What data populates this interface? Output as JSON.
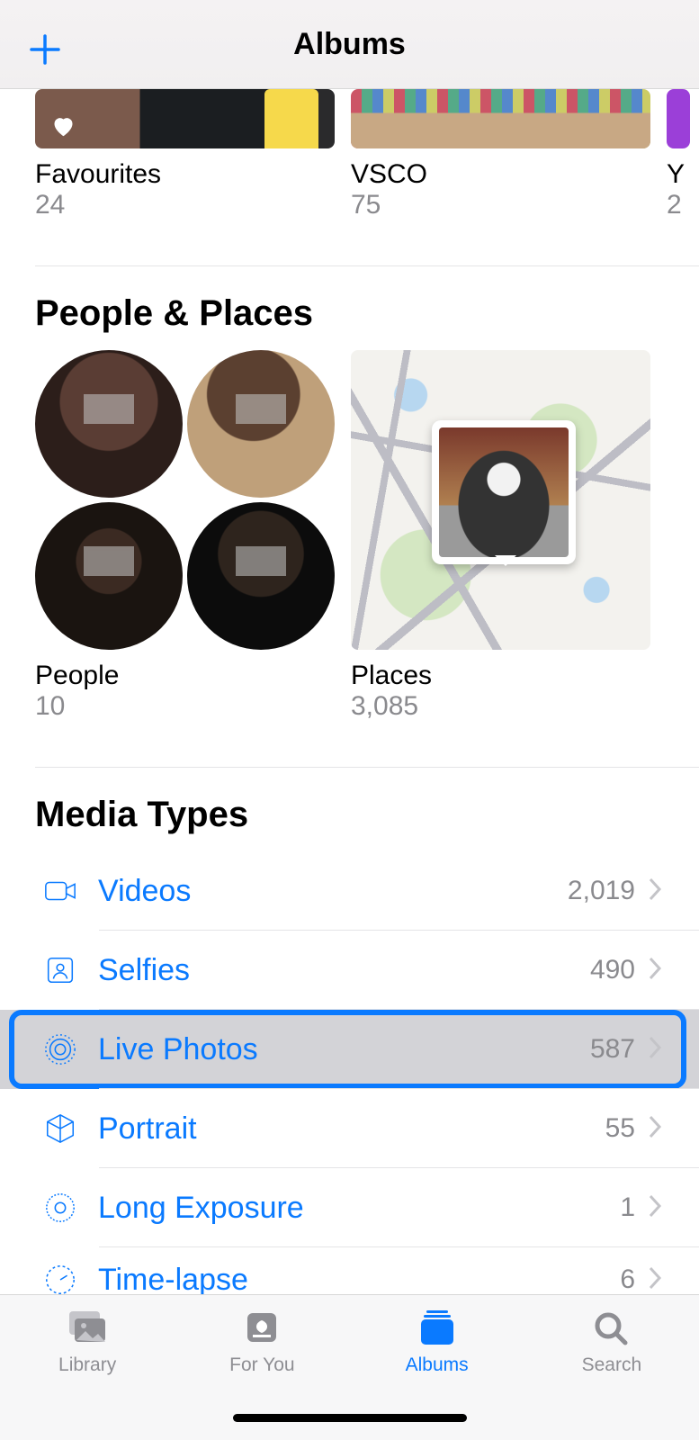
{
  "header": {
    "title": "Albums"
  },
  "myAlbums": [
    {
      "title": "Favourites",
      "count": "24"
    },
    {
      "title": "VSCO",
      "count": "75"
    },
    {
      "title": "Y",
      "count": "2"
    }
  ],
  "sections": {
    "peoplePlaces": "People & Places",
    "mediaTypes": "Media Types"
  },
  "peoplePlaces": [
    {
      "title": "People",
      "count": "10"
    },
    {
      "title": "Places",
      "count": "3,085"
    }
  ],
  "mediaTypes": [
    {
      "label": "Videos",
      "count": "2,019",
      "icon": "video"
    },
    {
      "label": "Selfies",
      "count": "490",
      "icon": "selfie"
    },
    {
      "label": "Live Photos",
      "count": "587",
      "icon": "live",
      "highlight": true
    },
    {
      "label": "Portrait",
      "count": "55",
      "icon": "cube"
    },
    {
      "label": "Long Exposure",
      "count": "1",
      "icon": "longexp"
    },
    {
      "label": "Time-lapse",
      "count": "6",
      "icon": "timelapse"
    }
  ],
  "tabs": [
    {
      "label": "Library"
    },
    {
      "label": "For You"
    },
    {
      "label": "Albums",
      "active": true
    },
    {
      "label": "Search"
    }
  ]
}
